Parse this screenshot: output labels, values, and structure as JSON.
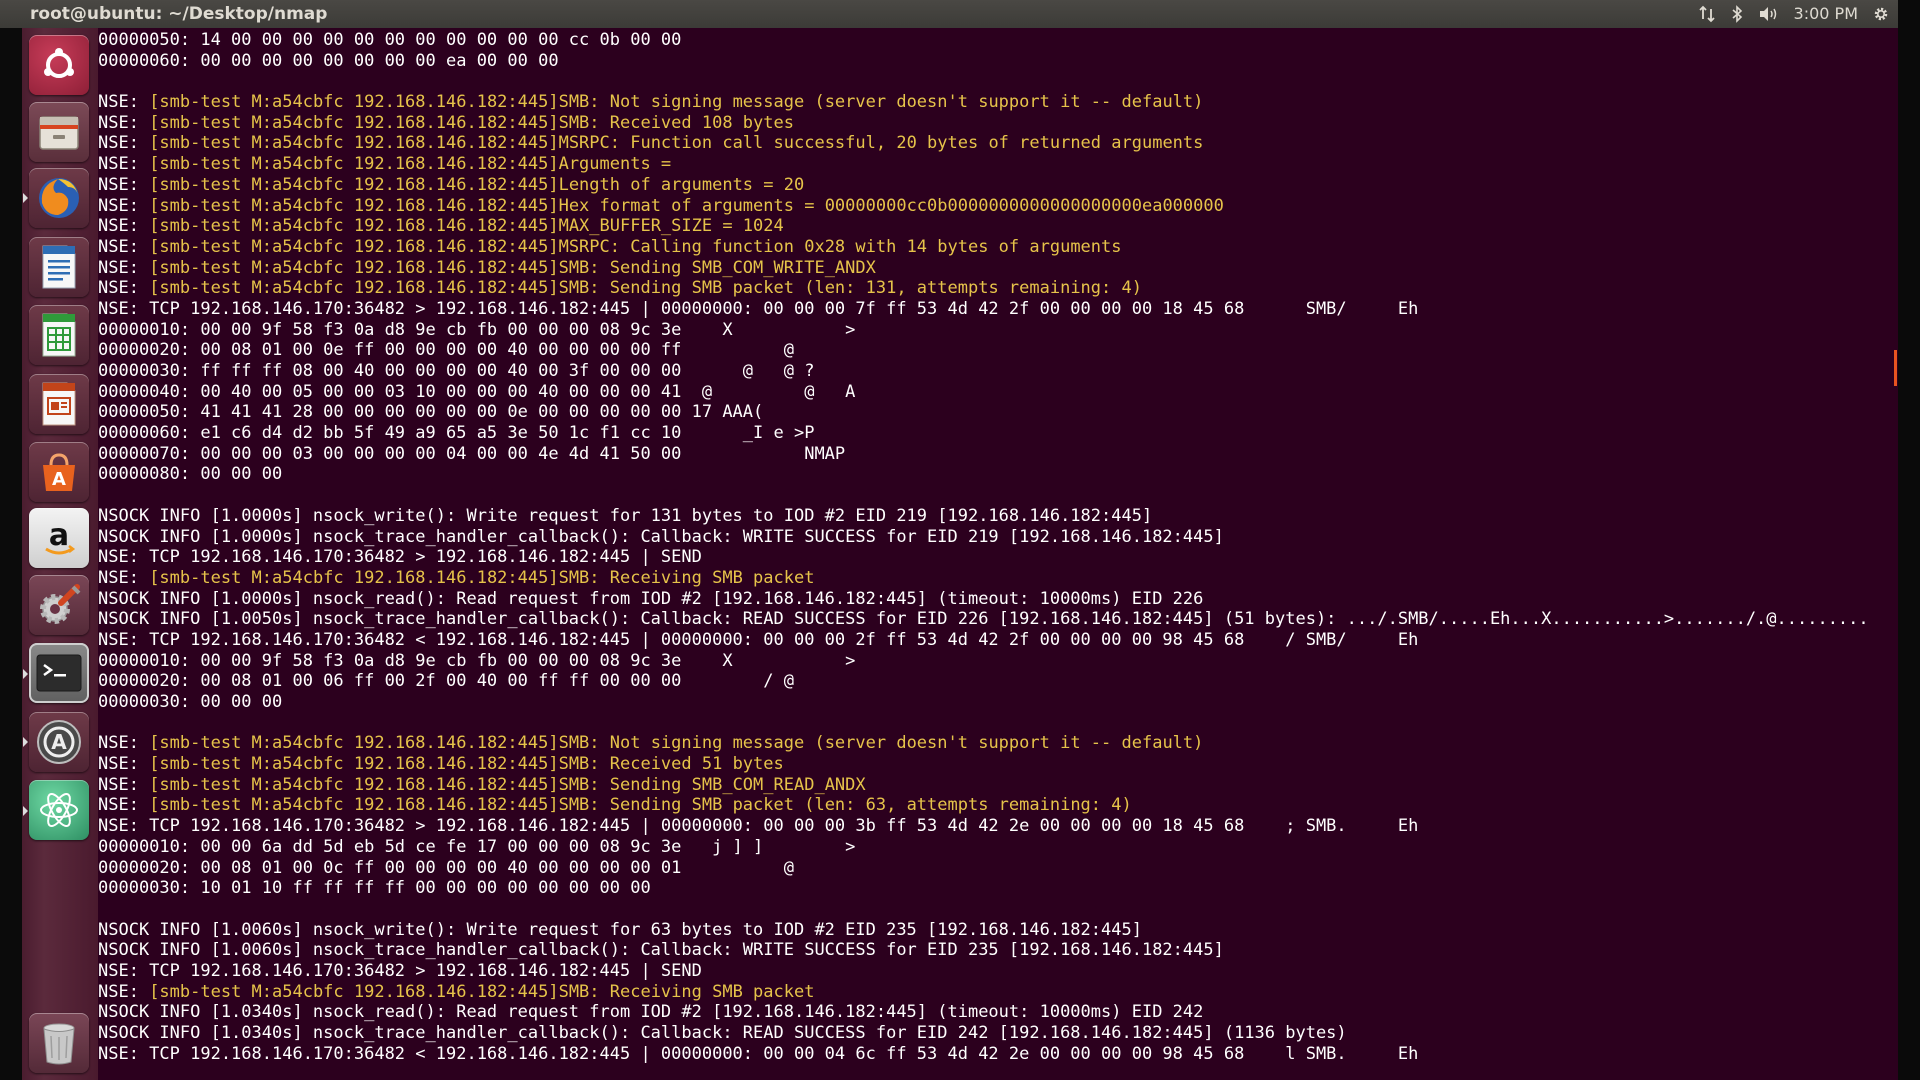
{
  "topbar": {
    "title": "root@ubuntu: ~/Desktop/nmap",
    "indicators": [
      "network-updown-icon",
      "bluetooth-icon",
      "volume-icon",
      "settings-gear-icon"
    ],
    "clock": "3:00 PM"
  },
  "launcher": {
    "items": [
      {
        "name": "ubuntu-dash-icon",
        "running": false
      },
      {
        "name": "files-icon",
        "running": false
      },
      {
        "name": "firefox-icon",
        "running": true
      },
      {
        "name": "libreoffice-writer-icon",
        "running": false
      },
      {
        "name": "libreoffice-calc-icon",
        "running": false
      },
      {
        "name": "libreoffice-impress-icon",
        "running": false
      },
      {
        "name": "software-center-icon",
        "running": false
      },
      {
        "name": "amazon-icon",
        "running": false
      },
      {
        "name": "system-settings-icon",
        "running": false
      },
      {
        "name": "terminal-icon",
        "running": true
      },
      {
        "name": "software-updater-icon",
        "running": true
      },
      {
        "name": "atom-icon",
        "running": true
      },
      {
        "name": "trash-icon",
        "running": false
      }
    ]
  },
  "colors": {
    "terminal_bg": "#2c001e",
    "terminal_fg": "#ffffff",
    "nse_highlight": "#e6c34a",
    "accent": "#e95420"
  },
  "terminal": {
    "lines": [
      {
        "text": "00000050: 14 00 00 00 00 00 00 00 00 00 00 00 cc 0b 00 00"
      },
      {
        "text": "00000060: 00 00 00 00 00 00 00 00 ea 00 00 00"
      },
      {
        "text": ""
      },
      {
        "tag": "NSE: ",
        "msg": "[smb-test M:a54cbfc 192.168.146.182:445]SMB: Not signing message (server doesn't support it -- default)"
      },
      {
        "tag": "NSE: ",
        "msg": "[smb-test M:a54cbfc 192.168.146.182:445]SMB: Received 108 bytes"
      },
      {
        "tag": "NSE: ",
        "msg": "[smb-test M:a54cbfc 192.168.146.182:445]MSRPC: Function call successful, 20 bytes of returned arguments"
      },
      {
        "tag": "NSE: ",
        "msg": "[smb-test M:a54cbfc 192.168.146.182:445]Arguments = "
      },
      {
        "tag": "NSE: ",
        "msg": "[smb-test M:a54cbfc 192.168.146.182:445]Length of arguments = 20"
      },
      {
        "tag": "NSE: ",
        "msg": "[smb-test M:a54cbfc 192.168.146.182:445]Hex format of arguments = 00000000cc0b0000000000000000000ea000000"
      },
      {
        "tag": "NSE: ",
        "msg": "[smb-test M:a54cbfc 192.168.146.182:445]MAX_BUFFER_SIZE = 1024"
      },
      {
        "tag": "NSE: ",
        "msg": "[smb-test M:a54cbfc 192.168.146.182:445]MSRPC: Calling function 0x28 with 14 bytes of arguments"
      },
      {
        "tag": "NSE: ",
        "msg": "[smb-test M:a54cbfc 192.168.146.182:445]SMB: Sending SMB_COM_WRITE_ANDX"
      },
      {
        "tag": "NSE: ",
        "msg": "[smb-test M:a54cbfc 192.168.146.182:445]SMB: Sending SMB packet (len: 131, attempts remaining: 4)"
      },
      {
        "text": "NSE: TCP 192.168.146.170:36482 > 192.168.146.182:445 | 00000000: 00 00 00 7f ff 53 4d 42 2f 00 00 00 00 18 45 68      SMB/     Eh"
      },
      {
        "text": "00000010: 00 00 9f 58 f3 0a d8 9e cb fb 00 00 00 08 9c 3e    X           >"
      },
      {
        "text": "00000020: 00 08 01 00 0e ff 00 00 00 00 40 00 00 00 00 ff          @"
      },
      {
        "text": "00000030: ff ff ff 08 00 40 00 00 00 00 40 00 3f 00 00 00      @   @ ?"
      },
      {
        "text": "00000040: 00 40 00 05 00 00 03 10 00 00 00 40 00 00 00 41  @         @   A"
      },
      {
        "text": "00000050: 41 41 41 28 00 00 00 00 00 00 0e 00 00 00 00 00 17 AAA("
      },
      {
        "text": "00000060: e1 c6 d4 d2 bb 5f 49 a9 65 a5 3e 50 1c f1 cc 10      _I e >P"
      },
      {
        "text": "00000070: 00 00 00 03 00 00 00 00 04 00 00 4e 4d 41 50 00            NMAP"
      },
      {
        "text": "00000080: 00 00 00"
      },
      {
        "text": ""
      },
      {
        "text": "NSOCK INFO [1.0000s] nsock_write(): Write request for 131 bytes to IOD #2 EID 219 [192.168.146.182:445]"
      },
      {
        "text": "NSOCK INFO [1.0000s] nsock_trace_handler_callback(): Callback: WRITE SUCCESS for EID 219 [192.168.146.182:445]"
      },
      {
        "text": "NSE: TCP 192.168.146.170:36482 > 192.168.146.182:445 | SEND"
      },
      {
        "tag": "NSE: ",
        "msg": "[smb-test M:a54cbfc 192.168.146.182:445]SMB: Receiving SMB packet"
      },
      {
        "text": "NSOCK INFO [1.0000s] nsock_read(): Read request from IOD #2 [192.168.146.182:445] (timeout: 10000ms) EID 226"
      },
      {
        "text": "NSOCK INFO [1.0050s] nsock_trace_handler_callback(): Callback: READ SUCCESS for EID 226 [192.168.146.182:445] (51 bytes): .../.SMB/.....Eh...X...........>......./.@........."
      },
      {
        "text": "NSE: TCP 192.168.146.170:36482 < 192.168.146.182:445 | 00000000: 00 00 00 2f ff 53 4d 42 2f 00 00 00 00 98 45 68    / SMB/     Eh"
      },
      {
        "text": "00000010: 00 00 9f 58 f3 0a d8 9e cb fb 00 00 00 08 9c 3e    X           >"
      },
      {
        "text": "00000020: 00 08 01 00 06 ff 00 2f 00 40 00 ff ff 00 00 00        / @"
      },
      {
        "text": "00000030: 00 00 00"
      },
      {
        "text": ""
      },
      {
        "tag": "NSE: ",
        "msg": "[smb-test M:a54cbfc 192.168.146.182:445]SMB: Not signing message (server doesn't support it -- default)"
      },
      {
        "tag": "NSE: ",
        "msg": "[smb-test M:a54cbfc 192.168.146.182:445]SMB: Received 51 bytes"
      },
      {
        "tag": "NSE: ",
        "msg": "[smb-test M:a54cbfc 192.168.146.182:445]SMB: Sending SMB_COM_READ_ANDX"
      },
      {
        "tag": "NSE: ",
        "msg": "[smb-test M:a54cbfc 192.168.146.182:445]SMB: Sending SMB packet (len: 63, attempts remaining: 4)"
      },
      {
        "text": "NSE: TCP 192.168.146.170:36482 > 192.168.146.182:445 | 00000000: 00 00 00 3b ff 53 4d 42 2e 00 00 00 00 18 45 68    ; SMB.     Eh"
      },
      {
        "text": "00000010: 00 00 6a dd 5d eb 5d ce fe 17 00 00 00 08 9c 3e   j ] ]        >"
      },
      {
        "text": "00000020: 00 08 01 00 0c ff 00 00 00 00 40 00 00 00 00 01          @"
      },
      {
        "text": "00000030: 10 01 10 ff ff ff ff 00 00 00 00 00 00 00 00"
      },
      {
        "text": ""
      },
      {
        "text": "NSOCK INFO [1.0060s] nsock_write(): Write request for 63 bytes to IOD #2 EID 235 [192.168.146.182:445]"
      },
      {
        "text": "NSOCK INFO [1.0060s] nsock_trace_handler_callback(): Callback: WRITE SUCCESS for EID 235 [192.168.146.182:445]"
      },
      {
        "text": "NSE: TCP 192.168.146.170:36482 > 192.168.146.182:445 | SEND"
      },
      {
        "tag": "NSE: ",
        "msg": "[smb-test M:a54cbfc 192.168.146.182:445]SMB: Receiving SMB packet"
      },
      {
        "text": "NSOCK INFO [1.0340s] nsock_read(): Read request from IOD #2 [192.168.146.182:445] (timeout: 10000ms) EID 242"
      },
      {
        "text": "NSOCK INFO [1.0340s] nsock_trace_handler_callback(): Callback: READ SUCCESS for EID 242 [192.168.146.182:445] (1136 bytes)"
      },
      {
        "text": "NSE: TCP 192.168.146.170:36482 < 192.168.146.182:445 | 00000000: 00 00 04 6c ff 53 4d 42 2e 00 00 00 00 98 45 68    l SMB.     Eh"
      }
    ]
  }
}
